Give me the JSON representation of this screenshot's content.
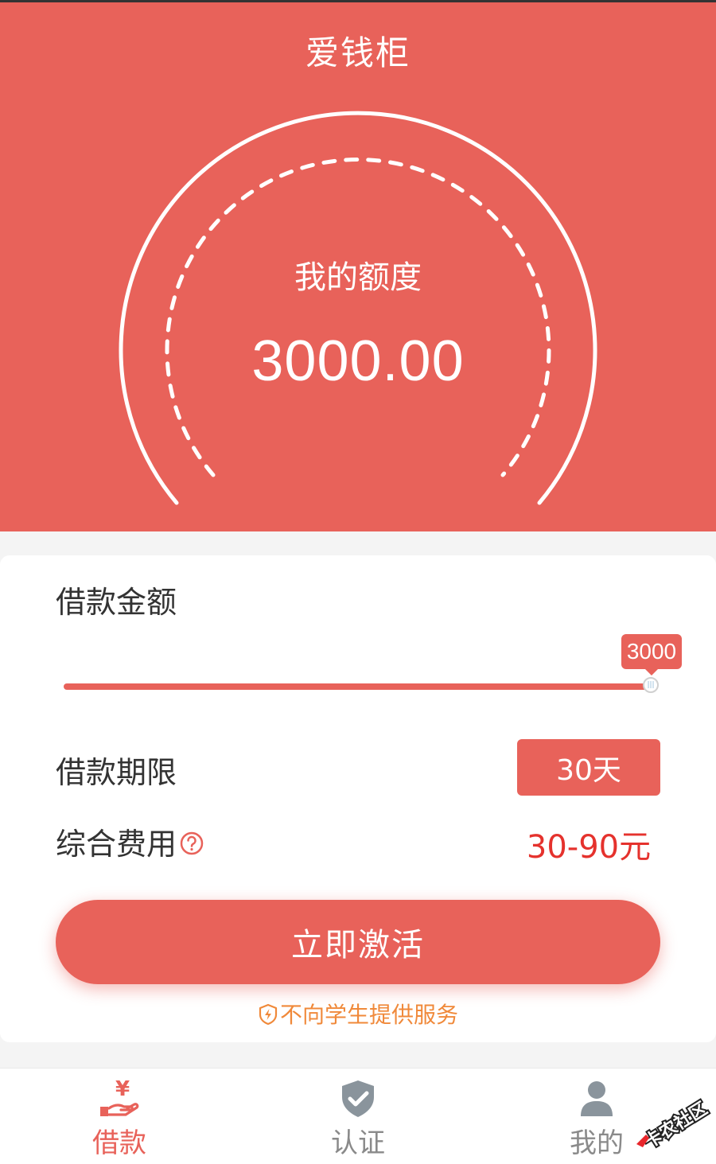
{
  "app": {
    "title": "爱钱柜"
  },
  "quota": {
    "label": "我的额度",
    "value": "3000.00"
  },
  "loan": {
    "amount_label": "借款金额",
    "amount_value": "3000",
    "amount_fraction": 1.0,
    "term_label": "借款期限",
    "term_value": "30天",
    "fee_label": "综合费用",
    "fee_value": "30-90元",
    "activate_label": "立即激活",
    "notice": "不向学生提供服务"
  },
  "tabs": [
    {
      "label": "借款",
      "icon": "yen-hand-icon",
      "active": true
    },
    {
      "label": "认证",
      "icon": "shield-check-icon",
      "active": false
    },
    {
      "label": "我的",
      "icon": "user-icon",
      "active": false
    }
  ],
  "watermark": {
    "text": "卡农社区"
  },
  "colors": {
    "primary": "#e8625a",
    "fee": "#e5322d",
    "notice": "#f0893a",
    "inactive": "#8a8a8a"
  }
}
